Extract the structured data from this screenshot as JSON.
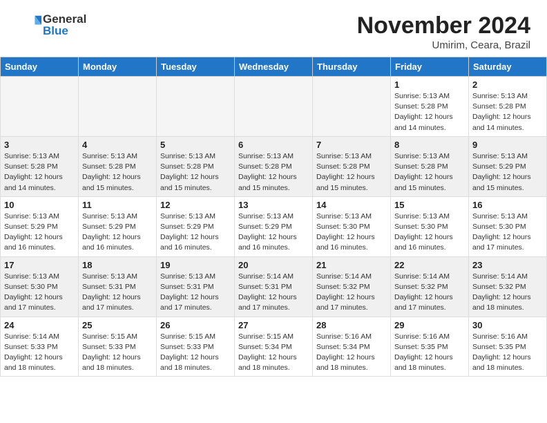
{
  "header": {
    "logo_line1": "General",
    "logo_line2": "Blue",
    "month": "November 2024",
    "location": "Umirim, Ceara, Brazil"
  },
  "weekdays": [
    "Sunday",
    "Monday",
    "Tuesday",
    "Wednesday",
    "Thursday",
    "Friday",
    "Saturday"
  ],
  "weeks": [
    [
      {
        "day": "",
        "info": ""
      },
      {
        "day": "",
        "info": ""
      },
      {
        "day": "",
        "info": ""
      },
      {
        "day": "",
        "info": ""
      },
      {
        "day": "",
        "info": ""
      },
      {
        "day": "1",
        "info": "Sunrise: 5:13 AM\nSunset: 5:28 PM\nDaylight: 12 hours\nand 14 minutes."
      },
      {
        "day": "2",
        "info": "Sunrise: 5:13 AM\nSunset: 5:28 PM\nDaylight: 12 hours\nand 14 minutes."
      }
    ],
    [
      {
        "day": "3",
        "info": "Sunrise: 5:13 AM\nSunset: 5:28 PM\nDaylight: 12 hours\nand 14 minutes."
      },
      {
        "day": "4",
        "info": "Sunrise: 5:13 AM\nSunset: 5:28 PM\nDaylight: 12 hours\nand 15 minutes."
      },
      {
        "day": "5",
        "info": "Sunrise: 5:13 AM\nSunset: 5:28 PM\nDaylight: 12 hours\nand 15 minutes."
      },
      {
        "day": "6",
        "info": "Sunrise: 5:13 AM\nSunset: 5:28 PM\nDaylight: 12 hours\nand 15 minutes."
      },
      {
        "day": "7",
        "info": "Sunrise: 5:13 AM\nSunset: 5:28 PM\nDaylight: 12 hours\nand 15 minutes."
      },
      {
        "day": "8",
        "info": "Sunrise: 5:13 AM\nSunset: 5:28 PM\nDaylight: 12 hours\nand 15 minutes."
      },
      {
        "day": "9",
        "info": "Sunrise: 5:13 AM\nSunset: 5:29 PM\nDaylight: 12 hours\nand 15 minutes."
      }
    ],
    [
      {
        "day": "10",
        "info": "Sunrise: 5:13 AM\nSunset: 5:29 PM\nDaylight: 12 hours\nand 16 minutes."
      },
      {
        "day": "11",
        "info": "Sunrise: 5:13 AM\nSunset: 5:29 PM\nDaylight: 12 hours\nand 16 minutes."
      },
      {
        "day": "12",
        "info": "Sunrise: 5:13 AM\nSunset: 5:29 PM\nDaylight: 12 hours\nand 16 minutes."
      },
      {
        "day": "13",
        "info": "Sunrise: 5:13 AM\nSunset: 5:29 PM\nDaylight: 12 hours\nand 16 minutes."
      },
      {
        "day": "14",
        "info": "Sunrise: 5:13 AM\nSunset: 5:30 PM\nDaylight: 12 hours\nand 16 minutes."
      },
      {
        "day": "15",
        "info": "Sunrise: 5:13 AM\nSunset: 5:30 PM\nDaylight: 12 hours\nand 16 minutes."
      },
      {
        "day": "16",
        "info": "Sunrise: 5:13 AM\nSunset: 5:30 PM\nDaylight: 12 hours\nand 17 minutes."
      }
    ],
    [
      {
        "day": "17",
        "info": "Sunrise: 5:13 AM\nSunset: 5:30 PM\nDaylight: 12 hours\nand 17 minutes."
      },
      {
        "day": "18",
        "info": "Sunrise: 5:13 AM\nSunset: 5:31 PM\nDaylight: 12 hours\nand 17 minutes."
      },
      {
        "day": "19",
        "info": "Sunrise: 5:13 AM\nSunset: 5:31 PM\nDaylight: 12 hours\nand 17 minutes."
      },
      {
        "day": "20",
        "info": "Sunrise: 5:14 AM\nSunset: 5:31 PM\nDaylight: 12 hours\nand 17 minutes."
      },
      {
        "day": "21",
        "info": "Sunrise: 5:14 AM\nSunset: 5:32 PM\nDaylight: 12 hours\nand 17 minutes."
      },
      {
        "day": "22",
        "info": "Sunrise: 5:14 AM\nSunset: 5:32 PM\nDaylight: 12 hours\nand 17 minutes."
      },
      {
        "day": "23",
        "info": "Sunrise: 5:14 AM\nSunset: 5:32 PM\nDaylight: 12 hours\nand 18 minutes."
      }
    ],
    [
      {
        "day": "24",
        "info": "Sunrise: 5:14 AM\nSunset: 5:33 PM\nDaylight: 12 hours\nand 18 minutes."
      },
      {
        "day": "25",
        "info": "Sunrise: 5:15 AM\nSunset: 5:33 PM\nDaylight: 12 hours\nand 18 minutes."
      },
      {
        "day": "26",
        "info": "Sunrise: 5:15 AM\nSunset: 5:33 PM\nDaylight: 12 hours\nand 18 minutes."
      },
      {
        "day": "27",
        "info": "Sunrise: 5:15 AM\nSunset: 5:34 PM\nDaylight: 12 hours\nand 18 minutes."
      },
      {
        "day": "28",
        "info": "Sunrise: 5:16 AM\nSunset: 5:34 PM\nDaylight: 12 hours\nand 18 minutes."
      },
      {
        "day": "29",
        "info": "Sunrise: 5:16 AM\nSunset: 5:35 PM\nDaylight: 12 hours\nand 18 minutes."
      },
      {
        "day": "30",
        "info": "Sunrise: 5:16 AM\nSunset: 5:35 PM\nDaylight: 12 hours\nand 18 minutes."
      }
    ]
  ]
}
